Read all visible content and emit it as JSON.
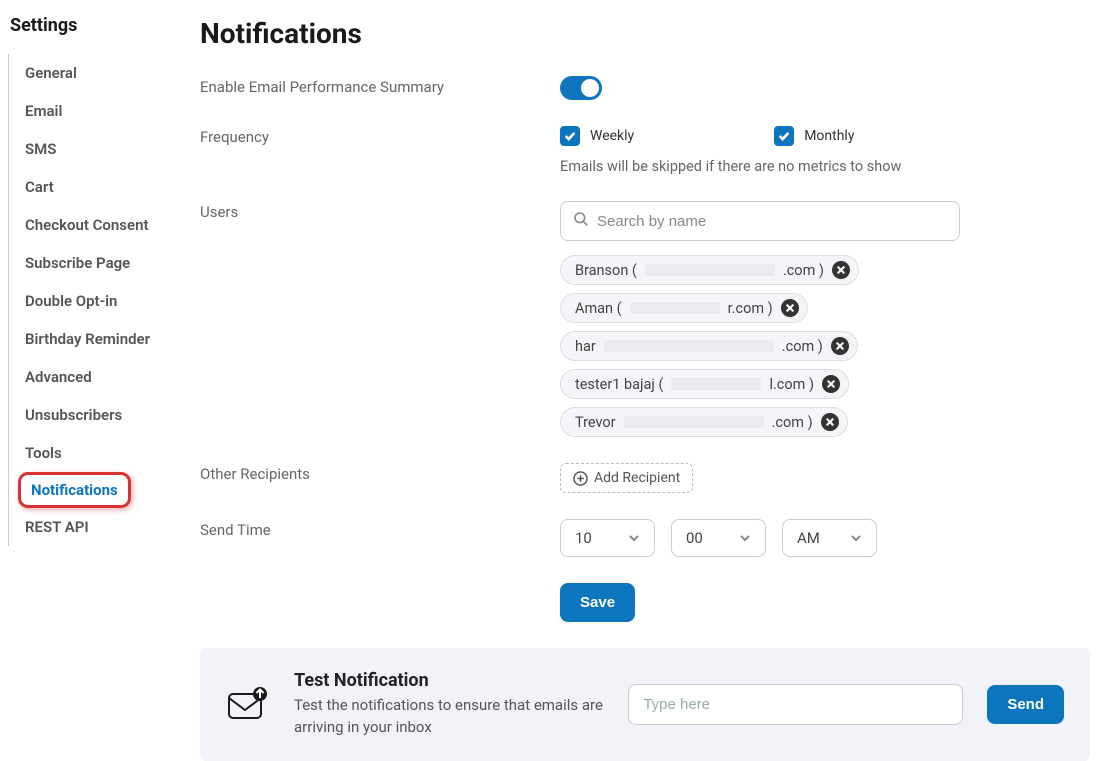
{
  "sidebar": {
    "title": "Settings",
    "items": [
      {
        "label": "General"
      },
      {
        "label": "Email"
      },
      {
        "label": "SMS"
      },
      {
        "label": "Cart"
      },
      {
        "label": "Checkout Consent"
      },
      {
        "label": "Subscribe Page"
      },
      {
        "label": "Double Opt-in"
      },
      {
        "label": "Birthday Reminder"
      },
      {
        "label": "Advanced"
      },
      {
        "label": "Unsubscribers"
      },
      {
        "label": "Tools"
      },
      {
        "label": "Notifications",
        "active": true
      },
      {
        "label": "REST API"
      }
    ]
  },
  "page": {
    "title": "Notifications"
  },
  "form": {
    "enable_label": "Enable Email Performance Summary",
    "enable_value": true,
    "frequency_label": "Frequency",
    "frequency_options": {
      "weekly_label": "Weekly",
      "weekly_checked": true,
      "monthly_label": "Monthly",
      "monthly_checked": true
    },
    "frequency_hint": "Emails will be skipped if there are no metrics to show",
    "users_label": "Users",
    "search_placeholder": "Search by name",
    "user_chips": [
      {
        "prefix": "Branson ( ",
        "hidden_width": 130,
        "suffix": ".com )"
      },
      {
        "prefix": "Aman ( ",
        "hidden_width": 90,
        "suffix": "r.com )"
      },
      {
        "prefix": "har",
        "hidden_width": 170,
        "suffix": ".com )"
      },
      {
        "prefix": "tester1 bajaj ( ",
        "hidden_width": 90,
        "suffix": "l.com )"
      },
      {
        "prefix": "Trevor ",
        "hidden_width": 140,
        "suffix": ".com )"
      }
    ],
    "other_recip_label": "Other Recipients",
    "add_recipient_label": "Add Recipient",
    "send_time_label": "Send Time",
    "send_time": {
      "hour": "10",
      "minute": "00",
      "ampm": "AM"
    },
    "save_label": "Save"
  },
  "test": {
    "title": "Test Notification",
    "desc": "Test the notifications to ensure that emails are arriving in your inbox",
    "input_placeholder": "Type here",
    "send_label": "Send"
  }
}
